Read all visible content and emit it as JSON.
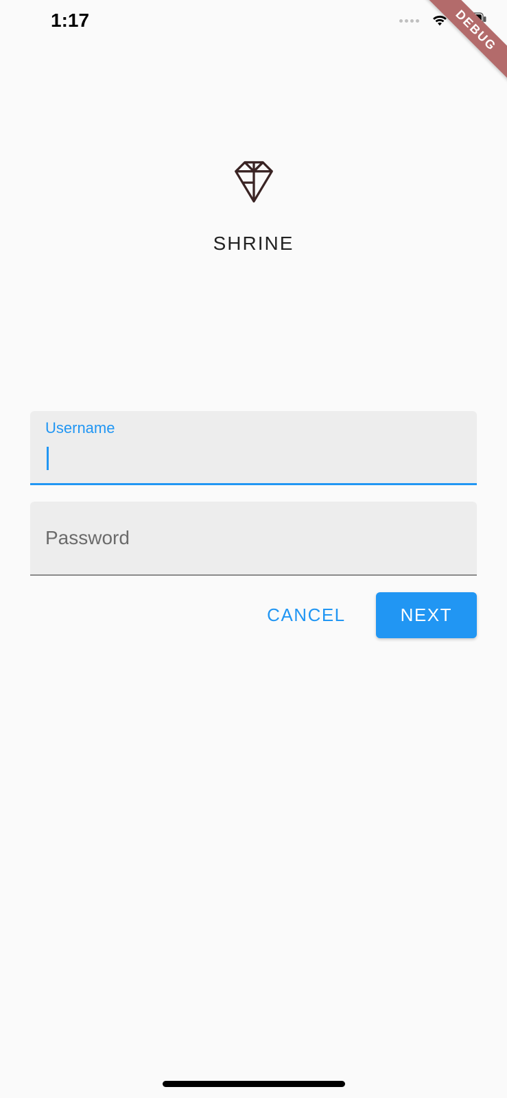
{
  "status": {
    "time": "1:17"
  },
  "debug": {
    "banner": "DEBUG"
  },
  "logo": {
    "title": "SHRINE"
  },
  "form": {
    "username": {
      "label": "Username",
      "value": ""
    },
    "password": {
      "placeholder": "Password",
      "value": ""
    }
  },
  "buttons": {
    "cancel": "CANCEL",
    "next": "NEXT"
  },
  "colors": {
    "accent": "#2196f3"
  }
}
